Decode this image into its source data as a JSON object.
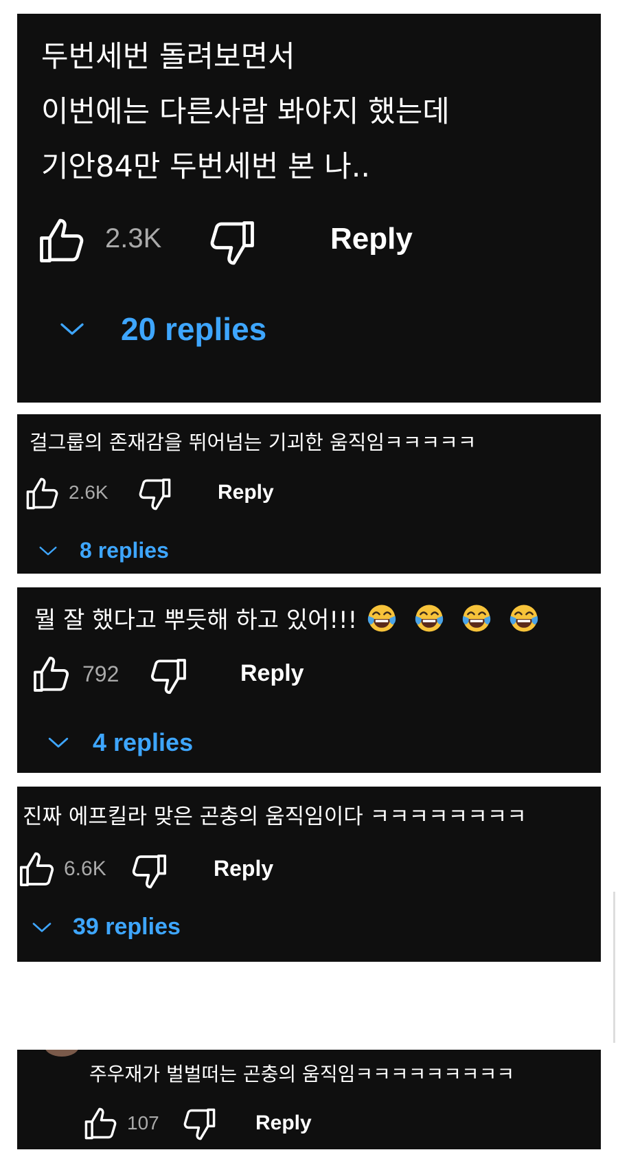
{
  "comments": [
    {
      "text_lines": [
        "두번세번 돌려보면서",
        "이번에는 다른사람 봐야지 했는데",
        "기안84만 두번세번 본 나.."
      ],
      "likes": "2.3K",
      "reply_label": "Reply",
      "replies_label": "20 replies"
    },
    {
      "text_lines": [
        "걸그룹의 존재감을 뛰어넘는 기괴한 움직임ㅋㅋㅋㅋㅋ"
      ],
      "likes": "2.6K",
      "reply_label": "Reply",
      "replies_label": "8 replies"
    },
    {
      "text_lines": [
        "뭘 잘 했다고 뿌듯해 하고 있어!!!"
      ],
      "emojis": [
        "face-with-tears-of-joy",
        "face-with-tears-of-joy",
        "face-with-tears-of-joy",
        "face-with-tears-of-joy"
      ],
      "likes": "792",
      "reply_label": "Reply",
      "replies_label": "4 replies"
    },
    {
      "text_lines": [
        "진짜 에프킬라 맞은 곤충의 움직임이다 ㅋㅋㅋㅋㅋㅋㅋㅋ"
      ],
      "likes": "6.6K",
      "reply_label": "Reply",
      "replies_label": "39 replies"
    },
    {
      "text_lines": [
        "주우재가 벌벌떠는 곤충의 움직임ㅋㅋㅋㅋㅋㅋㅋㅋㅋ"
      ],
      "likes": "107",
      "reply_label": "Reply"
    }
  ],
  "icons": {
    "like": "thumbs-up-outline-icon",
    "dislike": "thumbs-down-outline-icon",
    "expand": "chevron-down-icon"
  },
  "colors": {
    "card_background": "#0f0f0f",
    "text": "#ffffff",
    "count": "#aaaaaa",
    "replies_link": "#3ea6ff"
  }
}
